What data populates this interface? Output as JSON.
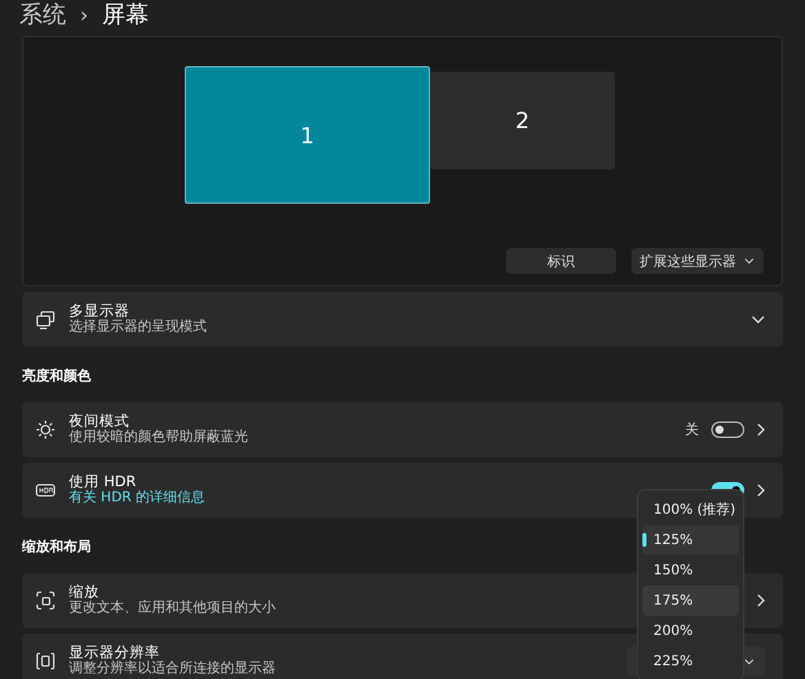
{
  "breadcrumb": {
    "parent": "系统",
    "separator": "›",
    "current": "屏幕"
  },
  "display_arrangement": {
    "monitors": [
      {
        "label": "1",
        "selected": true
      },
      {
        "label": "2",
        "selected": false
      }
    ],
    "buttons": [
      {
        "label": "标识",
        "kind": "button"
      },
      {
        "label": "扩展这些显示器",
        "kind": "dropdown"
      }
    ]
  },
  "sections": [
    {
      "items": [
        {
          "kind": "expander",
          "title": "多显示器",
          "subtitle": "选择显示器的呈现模式"
        }
      ]
    },
    {
      "header": "亮度和颜色",
      "items": [
        {
          "kind": "toggle",
          "title": "夜间模式",
          "subtitle": "使用较暗的颜色帮助屏蔽蓝光",
          "state_label": "关",
          "on": false
        },
        {
          "kind": "toggle",
          "title": "使用 HDR",
          "link": "有关 HDR 的详细信息",
          "on": true
        }
      ]
    },
    {
      "header": "缩放和布局",
      "items": [
        {
          "kind": "link",
          "title": "缩放",
          "subtitle": "更改文本、应用和其他项目的大小"
        },
        {
          "kind": "dropdown",
          "title": "显示器分辨率",
          "subtitle": "调整分辨率以适合所连接的显示器"
        }
      ]
    }
  ],
  "scale_menu": {
    "options": [
      {
        "label": "100% (推荐)",
        "selected": false,
        "hovered": false
      },
      {
        "label": "125%",
        "selected": true,
        "hovered": false
      },
      {
        "label": "150%",
        "selected": false,
        "hovered": false
      },
      {
        "label": "175%",
        "selected": false,
        "hovered": true
      },
      {
        "label": "200%",
        "selected": false,
        "hovered": false
      },
      {
        "label": "225%",
        "selected": false,
        "hovered": false
      }
    ]
  }
}
